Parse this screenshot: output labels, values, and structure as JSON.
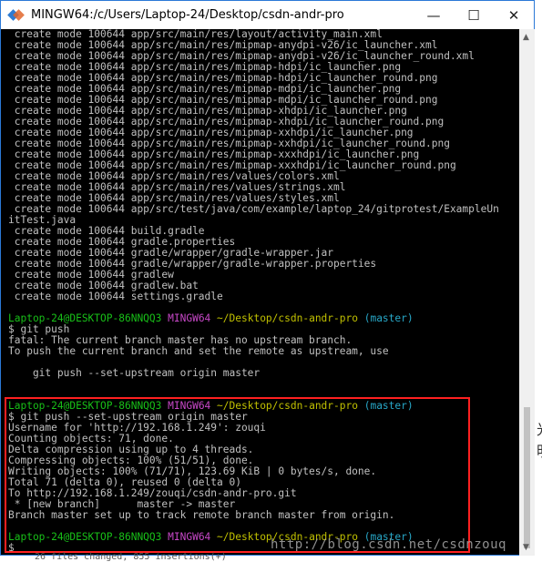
{
  "window": {
    "title": "MINGW64:/c/Users/Laptop-24/Desktop/csdn-andr-pro",
    "minimize_label": "—",
    "maximize_label": "☐",
    "close_label": "✕"
  },
  "terminal": {
    "lines": [
      {
        "t": "plain",
        "text": " create mode 100644 app/src/main/res/layout/activity_main.xml"
      },
      {
        "t": "plain",
        "text": " create mode 100644 app/src/main/res/mipmap-anydpi-v26/ic_launcher.xml"
      },
      {
        "t": "plain",
        "text": " create mode 100644 app/src/main/res/mipmap-anydpi-v26/ic_launcher_round.xml"
      },
      {
        "t": "plain",
        "text": " create mode 100644 app/src/main/res/mipmap-hdpi/ic_launcher.png"
      },
      {
        "t": "plain",
        "text": " create mode 100644 app/src/main/res/mipmap-hdpi/ic_launcher_round.png"
      },
      {
        "t": "plain",
        "text": " create mode 100644 app/src/main/res/mipmap-mdpi/ic_launcher.png"
      },
      {
        "t": "plain",
        "text": " create mode 100644 app/src/main/res/mipmap-mdpi/ic_launcher_round.png"
      },
      {
        "t": "plain",
        "text": " create mode 100644 app/src/main/res/mipmap-xhdpi/ic_launcher.png"
      },
      {
        "t": "plain",
        "text": " create mode 100644 app/src/main/res/mipmap-xhdpi/ic_launcher_round.png"
      },
      {
        "t": "plain",
        "text": " create mode 100644 app/src/main/res/mipmap-xxhdpi/ic_launcher.png"
      },
      {
        "t": "plain",
        "text": " create mode 100644 app/src/main/res/mipmap-xxhdpi/ic_launcher_round.png"
      },
      {
        "t": "plain",
        "text": " create mode 100644 app/src/main/res/mipmap-xxxhdpi/ic_launcher.png"
      },
      {
        "t": "plain",
        "text": " create mode 100644 app/src/main/res/mipmap-xxxhdpi/ic_launcher_round.png"
      },
      {
        "t": "plain",
        "text": " create mode 100644 app/src/main/res/values/colors.xml"
      },
      {
        "t": "plain",
        "text": " create mode 100644 app/src/main/res/values/strings.xml"
      },
      {
        "t": "plain",
        "text": " create mode 100644 app/src/main/res/values/styles.xml"
      },
      {
        "t": "plain",
        "text": " create mode 100644 app/src/test/java/com/example/laptop_24/gitprotest/ExampleUn"
      },
      {
        "t": "plain",
        "text": "itTest.java"
      },
      {
        "t": "plain",
        "text": " create mode 100644 build.gradle"
      },
      {
        "t": "plain",
        "text": " create mode 100644 gradle.properties"
      },
      {
        "t": "plain",
        "text": " create mode 100644 gradle/wrapper/gradle-wrapper.jar"
      },
      {
        "t": "plain",
        "text": " create mode 100644 gradle/wrapper/gradle-wrapper.properties"
      },
      {
        "t": "plain",
        "text": " create mode 100644 gradlew"
      },
      {
        "t": "plain",
        "text": " create mode 100644 gradlew.bat"
      },
      {
        "t": "plain",
        "text": " create mode 100644 settings.gradle"
      },
      {
        "t": "gap",
        "text": ""
      },
      {
        "t": "prompt",
        "user": "Laptop-24@DESKTOP-86NNQQ3",
        "env": "MINGW64",
        "path": "~/Desktop/csdn-andr-pro",
        "branch": "(master)"
      },
      {
        "t": "plain",
        "text": "$ git push"
      },
      {
        "t": "plain",
        "text": "fatal: The current branch master has no upstream branch."
      },
      {
        "t": "plain",
        "text": "To push the current branch and set the remote as upstream, use"
      },
      {
        "t": "gap",
        "text": ""
      },
      {
        "t": "plain",
        "text": "    git push --set-upstream origin master"
      },
      {
        "t": "gap",
        "text": ""
      },
      {
        "t": "gap",
        "text": ""
      },
      {
        "t": "prompt",
        "user": "Laptop-24@DESKTOP-86NNQQ3",
        "env": "MINGW64",
        "path": "~/Desktop/csdn-andr-pro",
        "branch": "(master)"
      },
      {
        "t": "plain",
        "text": "$ git push --set-upstream origin master"
      },
      {
        "t": "plain",
        "text": "Username for 'http://192.168.1.249': zouqi"
      },
      {
        "t": "plain",
        "text": "Counting objects: 71, done."
      },
      {
        "t": "plain",
        "text": "Delta compression using up to 4 threads."
      },
      {
        "t": "plain",
        "text": "Compressing objects: 100% (51/51), done."
      },
      {
        "t": "plain",
        "text": "Writing objects: 100% (71/71), 123.69 KiB | 0 bytes/s, done."
      },
      {
        "t": "plain",
        "text": "Total 71 (delta 0), reused 0 (delta 0)"
      },
      {
        "t": "plain",
        "text": "To http://192.168.1.249/zouqi/csdn-andr-pro.git"
      },
      {
        "t": "plain",
        "text": " * [new branch]      master -> master"
      },
      {
        "t": "plain",
        "text": "Branch master set up to track remote branch master from origin."
      },
      {
        "t": "gap",
        "text": ""
      },
      {
        "t": "prompt",
        "user": "Laptop-24@DESKTOP-86NNQQ3",
        "env": "MINGW64",
        "path": "~/Desktop/csdn-andr-pro",
        "branch": "(master)"
      },
      {
        "t": "plain",
        "text": "$ "
      }
    ]
  },
  "watermark": "http://blog.csdn.net/csdnzouq",
  "background_text": {
    "below": "26 files changed, 855 insertions(+)",
    "right_1": "光",
    "right_2": "明"
  },
  "colors": {
    "prompt_user": "#18c018",
    "prompt_env": "#c848c8",
    "prompt_path": "#c0c000",
    "prompt_branch": "#28a8c8",
    "highlight_border": "#ff2020"
  }
}
